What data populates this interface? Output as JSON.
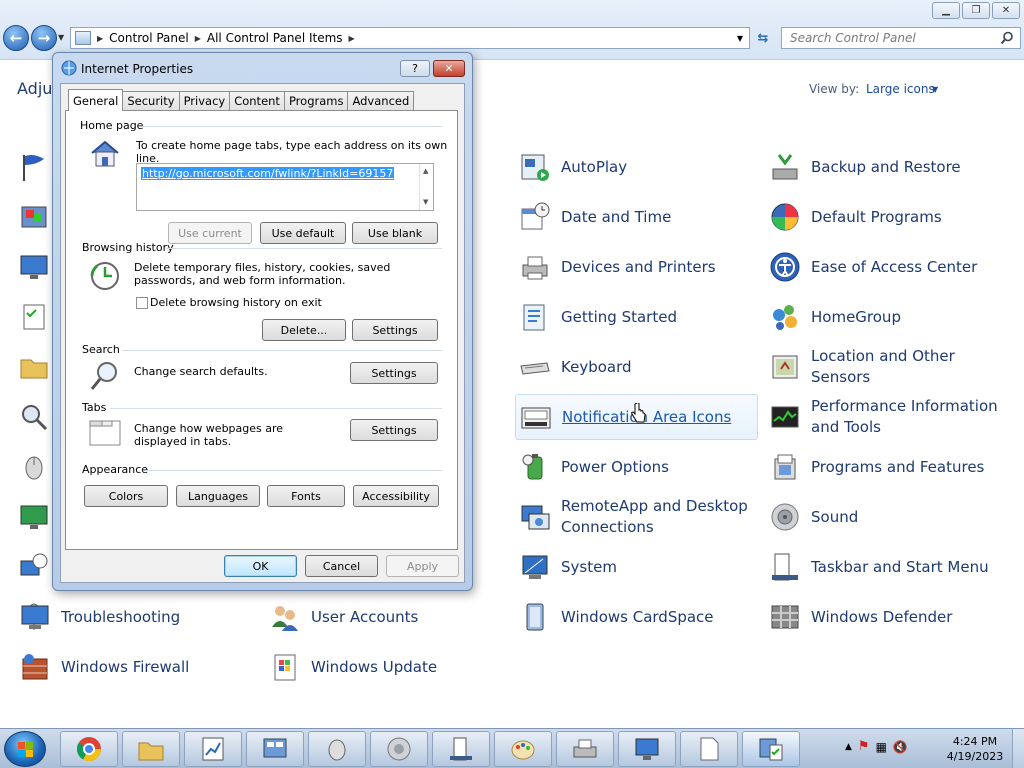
{
  "window": {
    "breadcrumb": [
      "Control Panel",
      "All Control Panel Items"
    ],
    "search_placeholder": "Search Control Panel",
    "caption_buttons": [
      "minimize-icon",
      "restore-icon",
      "close-icon"
    ]
  },
  "content": {
    "heading": "Adju",
    "view_by_label": "View by:",
    "view_by_value": "Large icons"
  },
  "items_col3": [
    {
      "label": "AutoPlay",
      "icon": "autoplay-icon"
    },
    {
      "label": "Date and Time",
      "icon": "date-time-icon"
    },
    {
      "label": "Devices and Printers",
      "icon": "printer-icon"
    },
    {
      "label": "Getting Started",
      "icon": "getting-started-icon"
    },
    {
      "label": "Keyboard",
      "icon": "keyboard-icon"
    },
    {
      "label": "Notification Area Icons",
      "icon": "notification-area-icon"
    },
    {
      "label": "Power Options",
      "icon": "power-icon"
    },
    {
      "label": "RemoteApp and Desktop Connections",
      "icon": "remoteapp-icon"
    },
    {
      "label": "System",
      "icon": "system-icon"
    },
    {
      "label": "Windows CardSpace",
      "icon": "cardspace-icon"
    }
  ],
  "items_col4": [
    {
      "label": "Backup and Restore",
      "icon": "backup-icon"
    },
    {
      "label": "Default Programs",
      "icon": "default-programs-icon"
    },
    {
      "label": "Ease of Access Center",
      "icon": "ease-of-access-icon"
    },
    {
      "label": "HomeGroup",
      "icon": "homegroup-icon"
    },
    {
      "label": "Location and Other Sensors",
      "icon": "location-sensors-icon"
    },
    {
      "label": "Performance Information and Tools",
      "icon": "performance-icon"
    },
    {
      "label": "Programs and Features",
      "icon": "programs-features-icon"
    },
    {
      "label": "Sound",
      "icon": "sound-icon"
    },
    {
      "label": "Taskbar and Start Menu",
      "icon": "taskbar-start-icon"
    },
    {
      "label": "Windows Defender",
      "icon": "defender-icon"
    }
  ],
  "items_bottom": [
    {
      "label": "Troubleshooting",
      "icon": "troubleshooting-icon"
    },
    {
      "label": "User Accounts",
      "icon": "user-accounts-icon"
    },
    {
      "label": "Windows Firewall",
      "icon": "firewall-icon"
    },
    {
      "label": "Windows Update",
      "icon": "windows-update-icon"
    }
  ],
  "dialog": {
    "title": "Internet Properties",
    "help": "?",
    "tabs": [
      "General",
      "Security",
      "Privacy",
      "Content",
      "Programs",
      "Advanced"
    ],
    "home_page": {
      "label": "Home page",
      "desc": "To create home page tabs, type each address on its own line.",
      "url": "http://go.microsoft.com/fwlink/?LinkId=69157",
      "use_current": "Use current",
      "use_default": "Use default",
      "use_blank": "Use blank"
    },
    "browsing_history": {
      "label": "Browsing history",
      "desc": "Delete temporary files, history, cookies, saved passwords, and web form information.",
      "checkbox_label": "Delete browsing history on exit",
      "checked": false,
      "delete": "Delete...",
      "settings": "Settings"
    },
    "search": {
      "label": "Search",
      "desc": "Change search defaults.",
      "settings": "Settings"
    },
    "tabs_section": {
      "label": "Tabs",
      "desc": "Change how webpages are displayed in tabs.",
      "settings": "Settings"
    },
    "appearance": {
      "label": "Appearance",
      "colors": "Colors",
      "languages": "Languages",
      "fonts": "Fonts",
      "accessibility": "Accessibility"
    },
    "ok": "OK",
    "cancel": "Cancel",
    "apply": "Apply"
  },
  "taskbar": {
    "apps": [
      "chrome-icon",
      "explorer-icon",
      "paint-chart-icon",
      "control-panel-icon",
      "mouse-icon",
      "speaker-icon",
      "server-icon",
      "paint-icon",
      "printer-icon",
      "monitor-icon",
      "document-icon",
      "control-panel-checklist-icon"
    ],
    "time": "4:24 PM",
    "date": "4/19/2023"
  },
  "colors": {
    "link": "#1e3a70",
    "accent": "#3399ff"
  }
}
